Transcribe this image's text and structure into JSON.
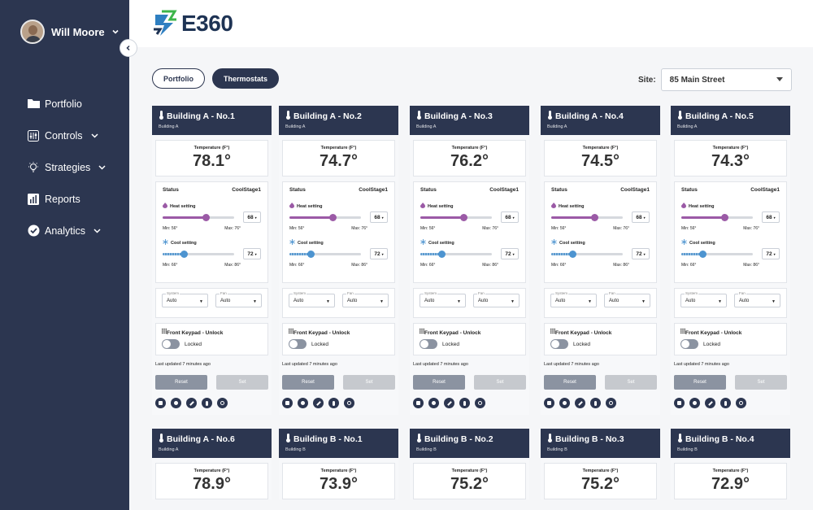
{
  "user": {
    "name": "Will Moore"
  },
  "nav": [
    {
      "label": "Portfolio",
      "icon": "folder-icon",
      "has_menu": false
    },
    {
      "label": "Controls",
      "icon": "sliders-icon",
      "has_menu": true
    },
    {
      "label": "Strategies",
      "icon": "lightbulb-icon",
      "has_menu": true
    },
    {
      "label": "Reports",
      "icon": "bar-chart-icon",
      "has_menu": false
    },
    {
      "label": "Analytics",
      "icon": "check-circle-icon",
      "has_menu": true
    }
  ],
  "logo": {
    "text": "E360"
  },
  "tabs": [
    {
      "label": "Portfolio",
      "active": false
    },
    {
      "label": "Thermostats",
      "active": true
    }
  ],
  "site": {
    "label": "Site:",
    "value": "85 Main Street"
  },
  "card_labels": {
    "temperature": "Temperature (F°)",
    "status": "Status",
    "heat": "Heat setting",
    "cool": "Cool setting",
    "system": "System",
    "fan": "Fan",
    "keypad": "Front Keypad - Unlock",
    "locked": "Locked",
    "reset": "Reset",
    "set": "Set"
  },
  "thermostats": [
    {
      "name": "Building A - No.1",
      "building": "Building A",
      "temp": "78.1°",
      "status": "CoolStage1",
      "heat": "68",
      "heat_min": "Min: 56°",
      "heat_max": "Max: 76°",
      "heat_level": 0.6,
      "cool": "72",
      "cool_min": "Min: 66°",
      "cool_max": "Max: 86°",
      "cool_level": 0.3,
      "system": "Auto",
      "fan": "Auto",
      "updated": "Last updated 7 minutes ago"
    },
    {
      "name": "Building A - No.2",
      "building": "Building A",
      "temp": "74.7°",
      "status": "CoolStage1",
      "heat": "68",
      "heat_min": "Min: 56°",
      "heat_max": "Max: 76°",
      "heat_level": 0.6,
      "cool": "72",
      "cool_min": "Min: 66°",
      "cool_max": "Max: 86°",
      "cool_level": 0.3,
      "system": "Auto",
      "fan": "Auto",
      "updated": "Last updated 7 minutes ago"
    },
    {
      "name": "Building A - No.3",
      "building": "Building A",
      "temp": "76.2°",
      "status": "CoolStage1",
      "heat": "68",
      "heat_min": "Min: 56°",
      "heat_max": "Max: 76°",
      "heat_level": 0.6,
      "cool": "72",
      "cool_min": "Min: 66°",
      "cool_max": "Max: 86°",
      "cool_level": 0.3,
      "system": "Auto",
      "fan": "Auto",
      "updated": "Last updated 7 minutes ago"
    },
    {
      "name": "Building A - No.4",
      "building": "Building A",
      "temp": "74.5°",
      "status": "CoolStage1",
      "heat": "68",
      "heat_min": "Min: 56°",
      "heat_max": "Max: 76°",
      "heat_level": 0.6,
      "cool": "72",
      "cool_min": "Min: 66°",
      "cool_max": "Max: 86°",
      "cool_level": 0.3,
      "system": "Auto",
      "fan": "Auto",
      "updated": "Last updated 7 minutes ago"
    },
    {
      "name": "Building A - No.5",
      "building": "Building A",
      "temp": "74.3°",
      "status": "CoolStage1",
      "heat": "68",
      "heat_min": "Min: 56°",
      "heat_max": "Max: 76°",
      "heat_level": 0.6,
      "cool": "72",
      "cool_min": "Min: 66°",
      "cool_max": "Max: 86°",
      "cool_level": 0.3,
      "system": "Auto",
      "fan": "Auto",
      "updated": "Last updated 7 minutes ago"
    },
    {
      "name": "Building A - No.6",
      "building": "Building A",
      "temp": "78.9°"
    },
    {
      "name": "Building B - No.1",
      "building": "Building B",
      "temp": "73.9°"
    },
    {
      "name": "Building B - No.2",
      "building": "Building B",
      "temp": "75.2°"
    },
    {
      "name": "Building B - No.3",
      "building": "Building B",
      "temp": "75.2°"
    },
    {
      "name": "Building B - No.4",
      "building": "Building B",
      "temp": "72.9°"
    }
  ]
}
